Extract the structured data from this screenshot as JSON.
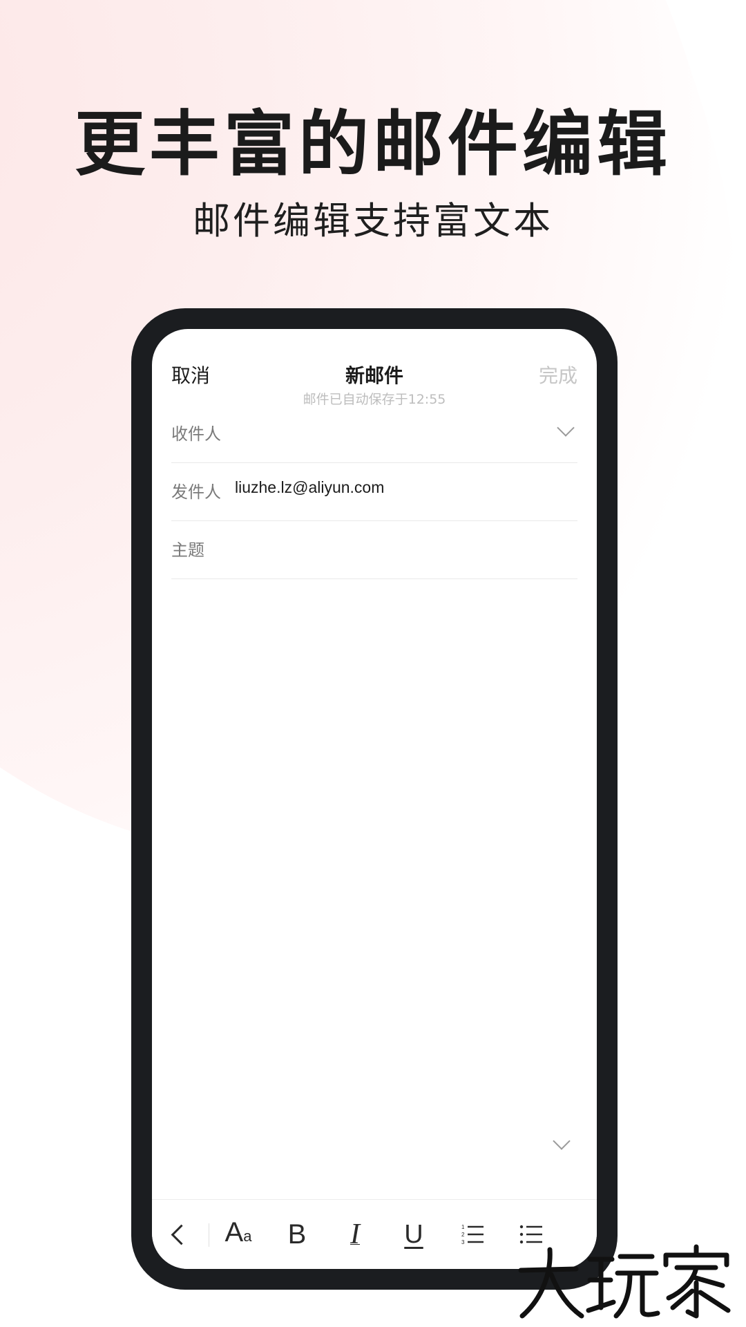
{
  "promo": {
    "headline": "更丰富的邮件编辑",
    "subheadline": "邮件编辑支持富文本"
  },
  "compose": {
    "nav": {
      "cancel_label": "取消",
      "title": "新邮件",
      "autosave_status": "邮件已自动保存于12:55",
      "done_label": "完成"
    },
    "fields": {
      "to_label": "收件人",
      "from_label": "发件人",
      "from_value": "liuzhe.lz@aliyun.com",
      "subject_label": "主题"
    }
  },
  "toolbar": {
    "items": [
      {
        "name": "back",
        "icon": "chevron-left-icon"
      },
      {
        "name": "font-size",
        "icon": "text-size-icon",
        "label": "Aa"
      },
      {
        "name": "bold",
        "icon": "bold-icon",
        "label": "B"
      },
      {
        "name": "italic",
        "icon": "italic-icon",
        "label": "I"
      },
      {
        "name": "underline",
        "icon": "underline-icon",
        "label": "U"
      },
      {
        "name": "ordered-list",
        "icon": "ordered-list-icon"
      },
      {
        "name": "bullet-list",
        "icon": "bullet-list-icon"
      }
    ]
  },
  "watermark": {
    "text": "大玩家"
  },
  "colors": {
    "accent_bg": "#fde6e6",
    "phone_frame": "#1b1d20",
    "text_primary": "#1b1b1b",
    "text_muted": "#7a7a7a",
    "done_disabled": "#c6c6c6"
  }
}
